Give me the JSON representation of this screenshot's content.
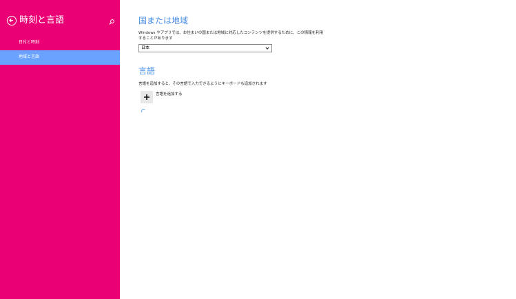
{
  "sidebar": {
    "title": "時刻と言語",
    "items": [
      {
        "label": "日付と時刻",
        "active": false
      },
      {
        "label": "地域と言語",
        "active": true
      }
    ]
  },
  "main": {
    "region": {
      "title": "国または地域",
      "description_line1": "Windows やアプリでは、お住まいの国または地域に対応したコンテンツを提供するために、この情報を利用",
      "description_line2": "することがあります",
      "selected": "日本"
    },
    "language": {
      "title": "言語",
      "description": "言語を追加すると、その言語で入力できるようにキーボードも追加されます",
      "add_label": "言語を追加する"
    }
  },
  "colors": {
    "sidebar_bg": "#ea0074",
    "active_item_bg": "#6aa3ff",
    "section_title": "#4a8fe6"
  },
  "icons": {
    "back": "back-arrow-icon",
    "search": "search-icon",
    "dropdown": "chevron-down-icon",
    "add": "plus-icon",
    "loading": "spinner-icon"
  }
}
